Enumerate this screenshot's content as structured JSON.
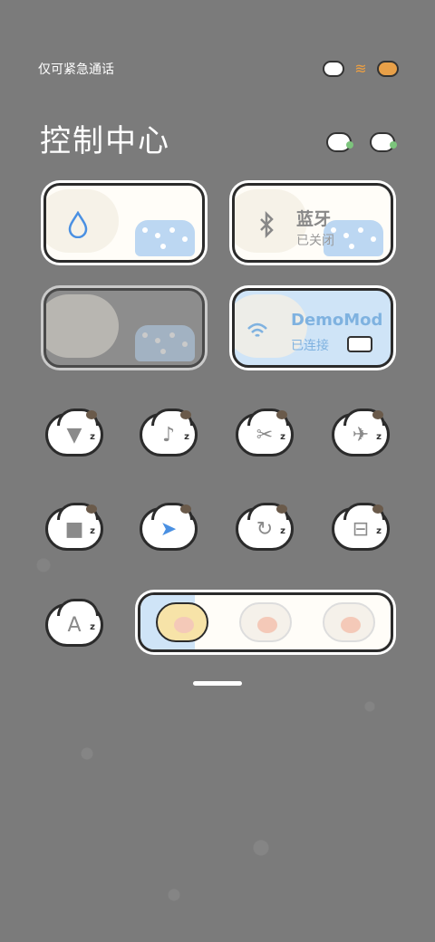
{
  "status_bar": {
    "carrier": "仅可紧急通话",
    "icons": [
      "cake-icon",
      "wifi-icon",
      "burger-icon"
    ]
  },
  "header": {
    "title": "控制中心",
    "icons": [
      "edit-sheep-icon",
      "settings-sheep-icon"
    ]
  },
  "cards": [
    {
      "id": "mobile-data",
      "icon": "water-drop-icon",
      "label": "",
      "sub": "",
      "state": "on"
    },
    {
      "id": "bluetooth",
      "icon": "bluetooth-icon",
      "label": "蓝牙",
      "sub": "已关闭",
      "state": "off"
    },
    {
      "id": "dimmed",
      "icon": "unknown-icon",
      "label": "",
      "sub": "",
      "state": "disabled"
    },
    {
      "id": "wifi",
      "icon": "wifi-icon",
      "label": "DemoMod",
      "sub": "已连接",
      "state": "on"
    }
  ],
  "toggles": [
    {
      "name": "flashlight",
      "icon": "flashlight-icon",
      "glyph": "▼"
    },
    {
      "name": "bell",
      "icon": "bell-icon",
      "glyph": "♪"
    },
    {
      "name": "screenshot",
      "icon": "scissors-icon",
      "glyph": "✂"
    },
    {
      "name": "airplane",
      "icon": "airplane-icon",
      "glyph": "✈"
    },
    {
      "name": "lock",
      "icon": "lock-icon",
      "glyph": "■"
    },
    {
      "name": "location",
      "icon": "location-icon",
      "glyph": "➤"
    },
    {
      "name": "rotation-lock",
      "icon": "rotation-lock-icon",
      "glyph": "↻"
    },
    {
      "name": "screen-scan",
      "icon": "scan-icon",
      "glyph": "⊟"
    },
    {
      "name": "font",
      "icon": "font-icon",
      "glyph": "A"
    }
  ],
  "theme_strip": {
    "items": [
      "theme-1",
      "theme-2",
      "theme-3"
    ],
    "selected": 0
  },
  "colors": {
    "background": "#7b7b7b",
    "card_border": "#2b2b2b",
    "accent_blue": "#4a90e2",
    "wifi_blue": "#7fb2e0"
  }
}
